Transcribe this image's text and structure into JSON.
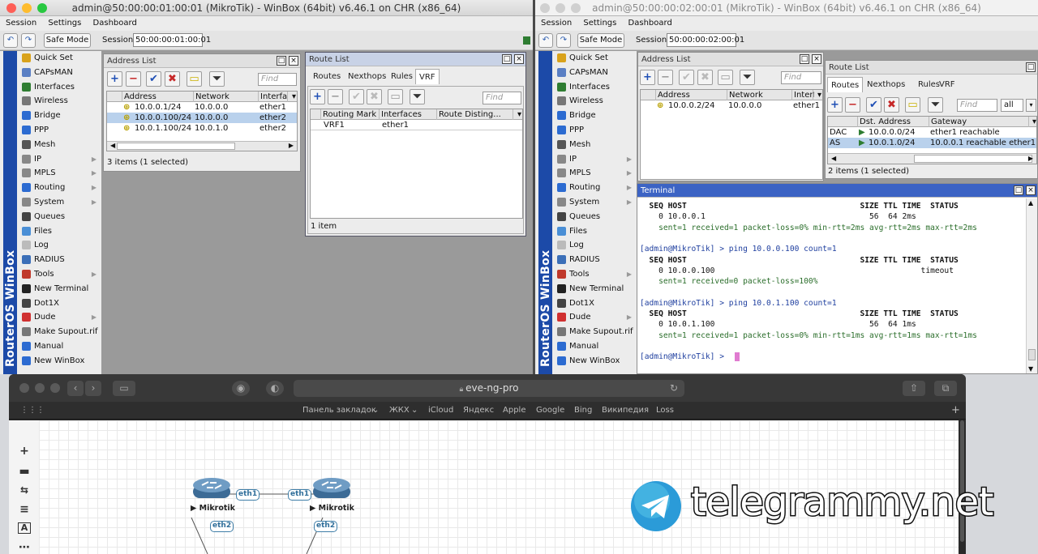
{
  "left_window": {
    "title": "admin@50:00:00:01:00:01 (MikroTik) - WinBox (64bit) v6.46.1 on CHR (x86_64)",
    "menu": [
      "Session",
      "Settings",
      "Dashboard"
    ],
    "safe_mode_label": "Safe Mode",
    "session_label": "Session:",
    "session_value": "50:00:00:01:00:01",
    "side_brand": "RouterOS WinBox",
    "address_list": {
      "title": "Address List",
      "find_placeholder": "Find",
      "columns": [
        "Address",
        "Network",
        "Interface"
      ],
      "rows": [
        {
          "address": "10.0.0.1/24",
          "network": "10.0.0.0",
          "interface": "ether1",
          "selected": false
        },
        {
          "address": "10.0.0.100/24",
          "network": "10.0.0.0",
          "interface": "ether2",
          "selected": true
        },
        {
          "address": "10.0.1.100/24",
          "network": "10.0.1.0",
          "interface": "ether2",
          "selected": false
        }
      ],
      "status": "3 items (1 selected)"
    },
    "route_list": {
      "title": "Route List",
      "tabs": [
        "Routes",
        "Nexthops",
        "Rules",
        "VRF"
      ],
      "active_tab": "VRF",
      "find_placeholder": "Find",
      "columns": [
        "Routing Mark",
        "Interfaces",
        "Route Disting..."
      ],
      "rows": [
        {
          "routing_mark": "VRF1",
          "interfaces": "ether1",
          "route_disting": ""
        }
      ],
      "status": "1 item"
    }
  },
  "right_window": {
    "title": "admin@50:00:00:02:00:01 (MikroTik) - WinBox (64bit) v6.46.1 on CHR (x86_64)",
    "menu": [
      "Session",
      "Settings",
      "Dashboard"
    ],
    "safe_mode_label": "Safe Mode",
    "session_label": "Session:",
    "session_value": "50:00:00:02:00:01",
    "side_brand": "RouterOS WinBox",
    "address_list": {
      "title": "Address List",
      "find_placeholder": "Find",
      "columns": [
        "Address",
        "Network",
        "Interface"
      ],
      "rows": [
        {
          "address": "10.0.0.2/24",
          "network": "10.0.0.0",
          "interface": "ether1"
        }
      ]
    },
    "route_list": {
      "title": "Route List",
      "tabs": [
        "Routes",
        "Nexthops",
        "Rules",
        "VRF"
      ],
      "active_tab": "Routes",
      "find_placeholder": "Find",
      "filter_value": "all",
      "columns": [
        "Dst. Address",
        "Gateway"
      ],
      "rows": [
        {
          "flags": "DAC",
          "dst": "10.0.0.0/24",
          "gateway": "ether1 reachable",
          "selected": false
        },
        {
          "flags": "AS",
          "dst": "10.0.1.0/24",
          "gateway": "10.0.0.1 reachable ether1",
          "selected": true
        }
      ],
      "status": "2 items (1 selected)"
    },
    "terminal": {
      "title": "Terminal",
      "lines": [
        "  SEQ HOST                                     SIZE TTL TIME  STATUS",
        "    0 10.0.0.1                                   56  64 2ms",
        "    sent=1 received=1 packet-loss=0% min-rtt=2ms avg-rtt=2ms max-rtt=2ms",
        "",
        "[admin@MikroTik] > ping 10.0.0.100 count=1",
        "  SEQ HOST                                     SIZE TTL TIME  STATUS",
        "    0 10.0.0.100                                            timeout",
        "    sent=1 received=0 packet-loss=100%",
        "",
        "[admin@MikroTik] > ping 10.0.1.100 count=1",
        "  SEQ HOST                                     SIZE TTL TIME  STATUS",
        "    0 10.0.1.100                                 56  64 1ms",
        "    sent=1 received=1 packet-loss=0% min-rtt=1ms avg-rtt=1ms max-rtt=1ms",
        "",
        "[admin@MikroTik] > "
      ]
    }
  },
  "side_menu": [
    {
      "label": "Quick Set",
      "icon": "quick-set-icon",
      "color": "#d9a21b",
      "sub": false
    },
    {
      "label": "CAPsMAN",
      "icon": "capsman-icon",
      "color": "#5a7fc4",
      "sub": false
    },
    {
      "label": "Interfaces",
      "icon": "interfaces-icon",
      "color": "#2f7d32",
      "sub": false
    },
    {
      "label": "Wireless",
      "icon": "wireless-icon",
      "color": "#777777",
      "sub": false
    },
    {
      "label": "Bridge",
      "icon": "bridge-icon",
      "color": "#2c6bd1",
      "sub": false
    },
    {
      "label": "PPP",
      "icon": "ppp-icon",
      "color": "#2c6bd1",
      "sub": false
    },
    {
      "label": "Mesh",
      "icon": "mesh-icon",
      "color": "#555555",
      "sub": false
    },
    {
      "label": "IP",
      "icon": "ip-icon",
      "color": "#888888",
      "sub": true
    },
    {
      "label": "MPLS",
      "icon": "mpls-icon",
      "color": "#888888",
      "sub": true
    },
    {
      "label": "Routing",
      "icon": "routing-icon",
      "color": "#2c6bd1",
      "sub": true
    },
    {
      "label": "System",
      "icon": "system-icon",
      "color": "#888888",
      "sub": true
    },
    {
      "label": "Queues",
      "icon": "queues-icon",
      "color": "#444444",
      "sub": false
    },
    {
      "label": "Files",
      "icon": "files-icon",
      "color": "#4a8fd6",
      "sub": false
    },
    {
      "label": "Log",
      "icon": "log-icon",
      "color": "#bbbbbb",
      "sub": false
    },
    {
      "label": "RADIUS",
      "icon": "radius-icon",
      "color": "#3b6fb8",
      "sub": false
    },
    {
      "label": "Tools",
      "icon": "tools-icon",
      "color": "#c0392b",
      "sub": true
    },
    {
      "label": "New Terminal",
      "icon": "terminal-icon",
      "color": "#222222",
      "sub": false
    },
    {
      "label": "Dot1X",
      "icon": "dot1x-icon",
      "color": "#444444",
      "sub": false
    },
    {
      "label": "Dude",
      "icon": "dude-icon",
      "color": "#d03030",
      "sub": true
    },
    {
      "label": "Make Supout.rif",
      "icon": "supout-icon",
      "color": "#777777",
      "sub": false
    },
    {
      "label": "Manual",
      "icon": "manual-icon",
      "color": "#2c6bd1",
      "sub": false
    },
    {
      "label": "New WinBox",
      "icon": "winbox-icon",
      "color": "#2c6bd1",
      "sub": false
    }
  ],
  "browser": {
    "url": "eve-ng-pro",
    "favorites": [
      "Панель закладок",
      "ЖКХ",
      "iCloud",
      "Яндекс",
      "Apple",
      "Google",
      "Bing",
      "Википедия",
      "Loss"
    ],
    "topology": {
      "routers": [
        {
          "label": "Mikrotik"
        },
        {
          "label": "Mikrotik"
        }
      ],
      "interfaces": [
        "eth1",
        "eth1",
        "eth2",
        "eth2"
      ]
    }
  },
  "watermark": "telegrammy.net"
}
